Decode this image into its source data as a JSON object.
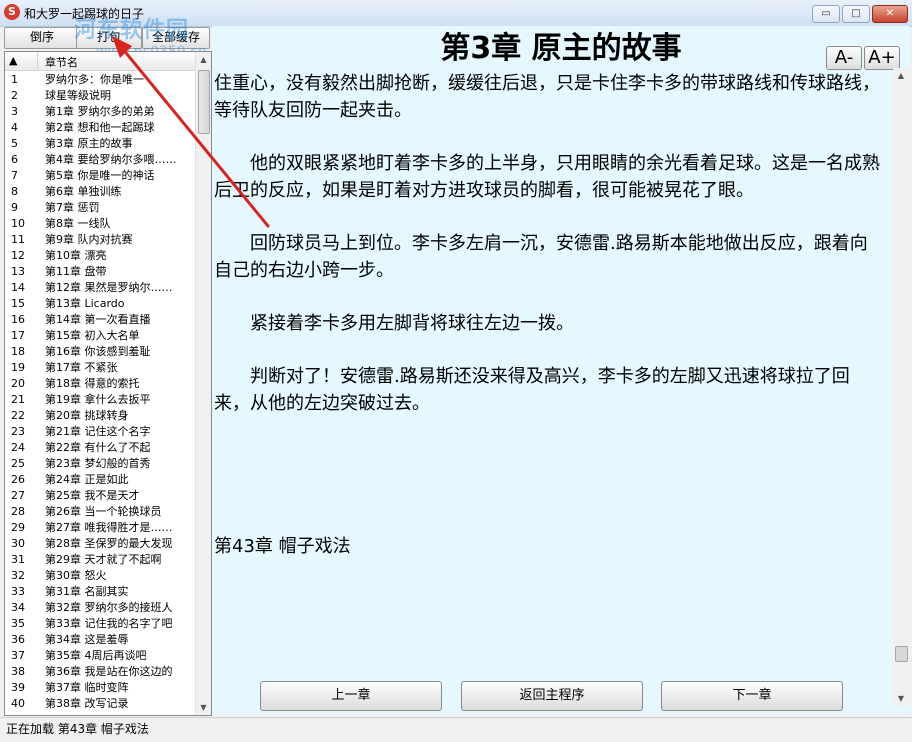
{
  "window": {
    "title": "和大罗一起踢球的日子",
    "watermark": "河东软件园",
    "watermark_url": "www.pc0359.cn",
    "controls": {
      "minimize": "▭",
      "maximize": "□",
      "close": "✕"
    }
  },
  "toolbar": {
    "sort_label": "倒序",
    "pack_label": "打包",
    "cache_label": "全部缓存"
  },
  "chapter_list": {
    "col_num": "▲",
    "col_name": "章节名",
    "rows": [
      {
        "num": "1",
        "name": "罗纳尔多：你是唯一"
      },
      {
        "num": "2",
        "name": "球星等级说明"
      },
      {
        "num": "3",
        "name": "第1章  罗纳尔多的弟弟"
      },
      {
        "num": "4",
        "name": "第2章  想和他一起踢球"
      },
      {
        "num": "5",
        "name": "第3章  原主的故事"
      },
      {
        "num": "6",
        "name": "第4章  要给罗纳尔多喂……"
      },
      {
        "num": "7",
        "name": "第5章  你是唯一的神话"
      },
      {
        "num": "8",
        "name": "第6章  单独训练"
      },
      {
        "num": "9",
        "name": "第7章  惩罚"
      },
      {
        "num": "10",
        "name": "第8章  一线队"
      },
      {
        "num": "11",
        "name": "第9章  队内对抗赛"
      },
      {
        "num": "12",
        "name": "第10章  漂亮"
      },
      {
        "num": "13",
        "name": "第11章  盘带"
      },
      {
        "num": "14",
        "name": "第12章  果然是罗纳尔……"
      },
      {
        "num": "15",
        "name": "第13章  Licardo"
      },
      {
        "num": "16",
        "name": "第14章  第一次看直播"
      },
      {
        "num": "17",
        "name": "第15章  初入大名单"
      },
      {
        "num": "18",
        "name": "第16章  你该感到羞耻"
      },
      {
        "num": "19",
        "name": "第17章  不紧张"
      },
      {
        "num": "20",
        "name": "第18章  得意的索托"
      },
      {
        "num": "21",
        "name": "第19章  拿什么去扳平"
      },
      {
        "num": "22",
        "name": "第20章  挑球转身"
      },
      {
        "num": "23",
        "name": "第21章  记住这个名字"
      },
      {
        "num": "24",
        "name": "第22章  有什么了不起"
      },
      {
        "num": "25",
        "name": "第23章  梦幻般的首秀"
      },
      {
        "num": "26",
        "name": "第24章  正是如此"
      },
      {
        "num": "27",
        "name": "第25章  我不是天才"
      },
      {
        "num": "28",
        "name": "第26章  当一个轮换球员"
      },
      {
        "num": "29",
        "name": "第27章  唯我得胜才是……"
      },
      {
        "num": "30",
        "name": "第28章  圣保罗的最大发现"
      },
      {
        "num": "31",
        "name": "第29章  天才就了不起啊"
      },
      {
        "num": "32",
        "name": "第30章  怒火"
      },
      {
        "num": "33",
        "name": "第31章  名副其实"
      },
      {
        "num": "34",
        "name": "第32章  罗纳尔多的接班人"
      },
      {
        "num": "35",
        "name": "第33章  记住我的名字了吧"
      },
      {
        "num": "36",
        "name": "第34章  这是羞辱"
      },
      {
        "num": "37",
        "name": "第35章  4周后再谈吧"
      },
      {
        "num": "38",
        "name": "第36章  我是站在你这边的"
      },
      {
        "num": "39",
        "name": "第37章  临时变阵"
      },
      {
        "num": "40",
        "name": "第38章  改写记录"
      }
    ]
  },
  "reader": {
    "chapter_title": "第3章 原主的故事",
    "font_decrease": "A-",
    "font_increase": "A+",
    "paragraphs": [
      "住重心，没有毅然出脚抢断，缓缓往后退，只是卡住李卡多的带球路线和传球路线，等待队友回防一起夹击。",
      "　　他的双眼紧紧地盯着李卡多的上半身，只用眼睛的余光看着足球。这是一名成熟后卫的反应，如果是盯着对方进攻球员的脚看，很可能被晃花了眼。",
      "　　回防球员马上到位。李卡多左肩一沉，安德雷.路易斯本能地做出反应，跟着向自己的右边小跨一步。",
      "　　紧接着李卡多用左脚背将球往左边一拨。",
      "　　判断对了！安德雷.路易斯还没来得及高兴，李卡多的左脚又迅速将球拉了回来，从他的左边突破过去。"
    ],
    "next_chapter_heading": "第43章 帽子戏法",
    "nav": {
      "prev": "上一章",
      "home": "返回主程序",
      "next": "下一章"
    }
  },
  "status": {
    "text": "正在加载 第43章 帽子戏法"
  },
  "colors": {
    "reader_bg": "#e4f8fe",
    "annotation_arrow": "#d9231f",
    "close_button": "#c7432c"
  }
}
